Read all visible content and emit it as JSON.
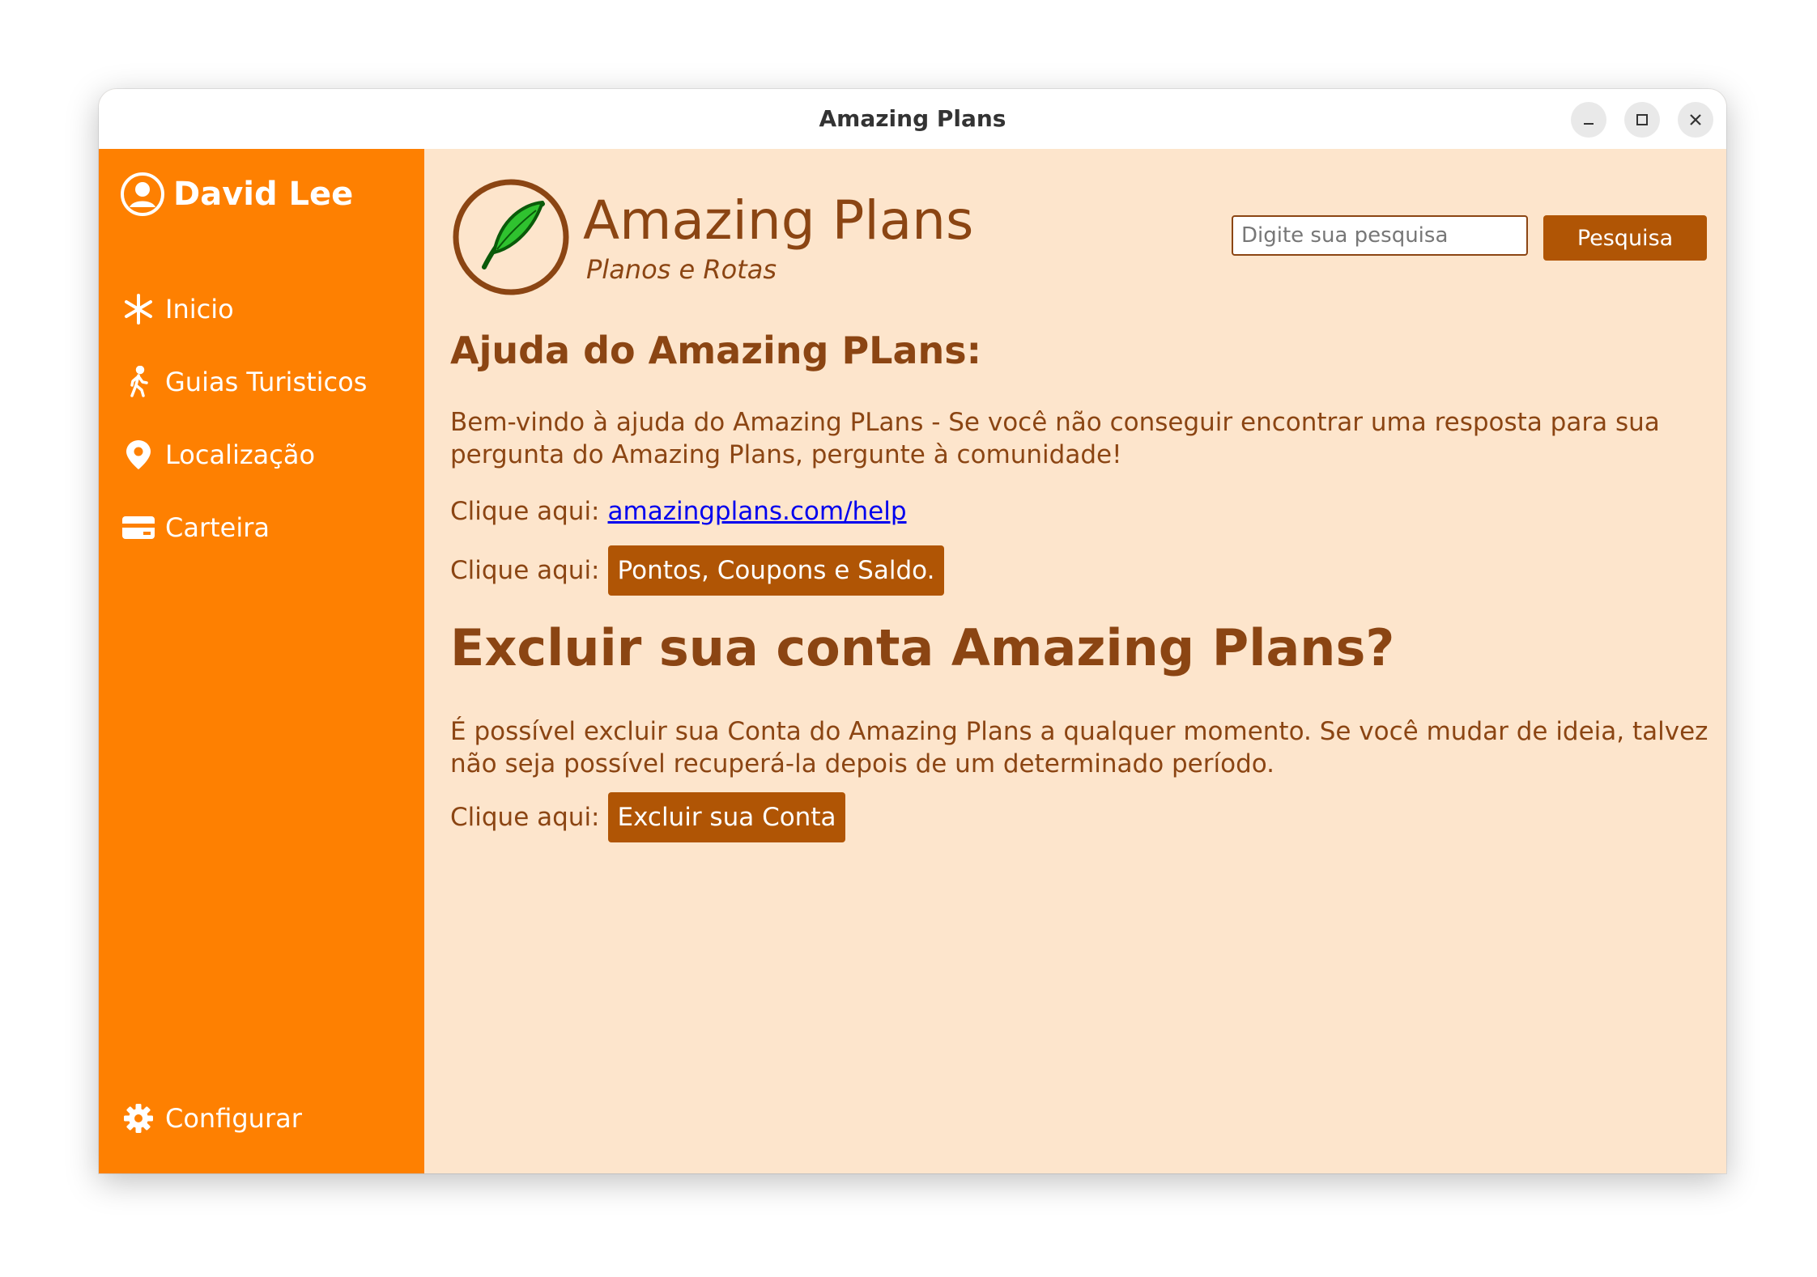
{
  "window": {
    "title": "Amazing Plans",
    "controls": {
      "minimize_icon": "minimize-icon",
      "maximize_icon": "maximize-icon",
      "close_icon": "close-icon"
    }
  },
  "sidebar": {
    "user_name": "David Lee",
    "user_icon": "user-circle-icon",
    "items": [
      {
        "label": "Inicio",
        "icon": "asterisk-icon"
      },
      {
        "label": "Guias Turisticos",
        "icon": "walking-person-icon"
      },
      {
        "label": "Localização",
        "icon": "map-pin-icon"
      },
      {
        "label": "Carteira",
        "icon": "wallet-card-icon"
      }
    ],
    "settings_label": "Configurar",
    "settings_icon": "gear-icon",
    "background_color": "#fe8001"
  },
  "header": {
    "brand": "Amazing Plans",
    "tagline": "Planos e Rotas",
    "logo_icon": "feather-icon",
    "search": {
      "placeholder": "Digite sua pesquisa",
      "value": "",
      "button_label": "Pesquisa"
    }
  },
  "help": {
    "title": "Ajuda do Amazing PLans:",
    "intro": "Bem-vindo à ajuda do Amazing PLans - Se você não conseguir encontrar uma resposta para sua pergunta do Amazing Plans, pergunte à comunidade!",
    "link_prefix": "Clique aqui:",
    "link_text": "amazingplans.com/help",
    "button_prefix": "Clique aqui:",
    "button_label": "Pontos, Coupons e Saldo."
  },
  "delete_account": {
    "title": "Excluir sua conta Amazing Plans?",
    "text": "É possível excluir sua Conta do Amazing Plans a qualquer momento. Se você mudar de ideia, talvez não seja possível recuperá-la depois de um determinado período.",
    "button_prefix": "Clique aqui:",
    "button_label": "Excluir sua Conta"
  },
  "colors": {
    "accent": "#fe8001",
    "brown": "#8b4513",
    "button": "#b05505",
    "content_bg": "#fde5cc",
    "link": "#0000ee"
  }
}
